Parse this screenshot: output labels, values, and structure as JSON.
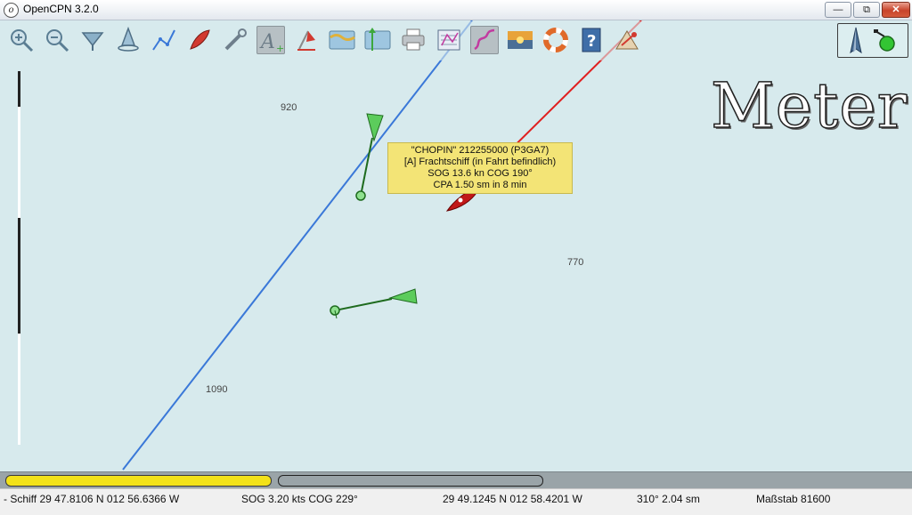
{
  "window": {
    "title": "OpenCPN 3.2.0"
  },
  "toolbar": {
    "buttons": [
      {
        "icon": "zoom-in-icon"
      },
      {
        "icon": "zoom-out-icon"
      },
      {
        "icon": "chart-quilt-icon"
      },
      {
        "icon": "ship-centered-icon"
      },
      {
        "icon": "create-route-icon"
      },
      {
        "icon": "auto-follow-icon"
      },
      {
        "icon": "settings-icon"
      },
      {
        "icon": "text-toggle-icon",
        "active": true
      },
      {
        "icon": "current-tide-icon"
      },
      {
        "icon": "tides-icon"
      },
      {
        "icon": "currents-icon"
      },
      {
        "icon": "print-icon"
      },
      {
        "icon": "route-manager-icon"
      },
      {
        "icon": "track-icon",
        "active": true
      },
      {
        "icon": "color-scheme-icon"
      },
      {
        "icon": "mob-icon"
      },
      {
        "icon": "help-icon"
      },
      {
        "icon": "ais-icon"
      }
    ]
  },
  "chart": {
    "overlay_text": "Meter",
    "depths": [
      {
        "id": "d1",
        "label": "920"
      },
      {
        "id": "d2",
        "label": "770"
      },
      {
        "id": "d3",
        "label": "1090"
      }
    ]
  },
  "ais_target": {
    "line1": "\"CHOPIN\" 212255000 (P3GA7)",
    "line2": "[A] Frachtschiff (in Fahrt befindlich)",
    "line3": "SOG 13.6 kn  COG 190°",
    "line4": "CPA 1.50 sm in 8 min"
  },
  "status": {
    "ship_position": "- Schiff 29 47.8106 N   012 56.6366 W",
    "sog_cog": "SOG 3.20 kts   COG 229°",
    "cursor_position": "29 49.1245 N    012 58.4201 W",
    "bearing_distance": "310°   2.04 sm",
    "scale": "Maßstab 81600"
  },
  "colors": {
    "route_blue": "#3a78d8",
    "target_red": "#e02020",
    "ais_green": "#3da83d",
    "tooltip_yellow": "#f3e476"
  }
}
